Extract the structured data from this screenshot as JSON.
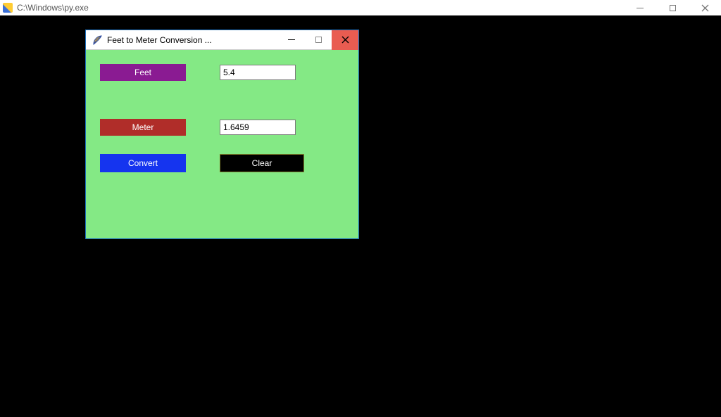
{
  "outer": {
    "title": "C:\\Windows\\py.exe"
  },
  "tk": {
    "title": "Feet to Meter Conversion ...",
    "labels": {
      "feet": "Feet",
      "meter": "Meter"
    },
    "inputs": {
      "feet_value": "5.4",
      "meter_value": "1.6459"
    },
    "buttons": {
      "convert": "Convert",
      "clear": "Clear"
    }
  }
}
